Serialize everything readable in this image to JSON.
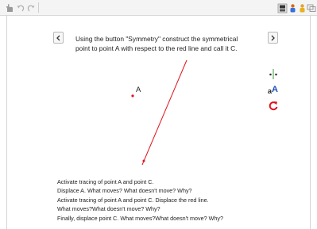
{
  "toolbar": {
    "left_icons": [
      "hand-pointer-icon",
      "undo-icon",
      "redo-icon"
    ],
    "right_icons": [
      "algebra-view-icon",
      "users-icon",
      "person-icon",
      "perspectives-icon"
    ]
  },
  "navigation": {
    "prev_icon": "chevron-left-icon",
    "next_icon": "chevron-right-icon"
  },
  "instruction": "Using the button \"Symmetry\" construct the symmetrical point to point A with respect to the red line and call it C.",
  "side_tools": [
    "symmetry-tool-icon",
    "text-label-tool-icon",
    "reset-icon"
  ],
  "construction": {
    "point_label": "A",
    "accent_color": "#e0141e"
  },
  "tasks": [
    "Activate tracing of point A and point C.",
    "Displace A. What moves? What doesn't move? Why?",
    "Activate tracing of point A and point C. Displace the red line.",
    "What moves?What doesn't move? Why?",
    "Finally, displace point C. What moves?What doesn't move? Why?"
  ]
}
